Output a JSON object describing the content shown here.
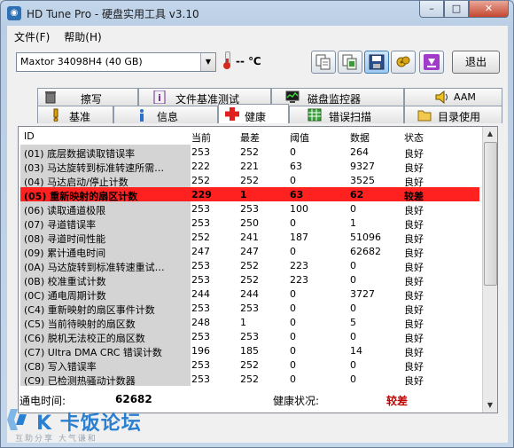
{
  "window": {
    "title": "HD Tune Pro - 硬盘实用工具 v3.10",
    "buttons": {
      "minimize": "0",
      "maximize": "1",
      "close": "r"
    }
  },
  "menu": [
    "文件(F)",
    "帮助(H)"
  ],
  "toolbar": {
    "drive": "Maxtor 34098H4 (40 GB)",
    "temperature": "-- ℃",
    "exit_label": "退出",
    "icons": [
      "copy-text-icon",
      "copy-screen-icon",
      "save-icon",
      "options-icon",
      "download-icon"
    ]
  },
  "tabs_row1": [
    {
      "label": "擦写",
      "icon": "trash-icon"
    },
    {
      "label": "文件基准测试",
      "icon": "file-info-icon"
    },
    {
      "label": "磁盘监控器",
      "icon": "monitor-icon"
    },
    {
      "label": "AAM",
      "icon": "speaker-icon"
    }
  ],
  "tabs_row2": [
    {
      "label": "基准",
      "icon": "exclamation-icon"
    },
    {
      "label": "信息",
      "icon": "info-icon"
    },
    {
      "label": "健康",
      "icon": "health-cross-icon",
      "active": true
    },
    {
      "label": "错误扫描",
      "icon": "grid-scan-icon"
    },
    {
      "label": "目录使用",
      "icon": "folder-icon"
    }
  ],
  "health": {
    "columns": [
      "ID",
      "当前",
      "最差",
      "阈值",
      "数据",
      "状态"
    ],
    "rows": [
      {
        "id": "(01) 底层数据读取错误率",
        "cur": "253",
        "worst": "252",
        "thr": "0",
        "data": "264",
        "status": "良好"
      },
      {
        "id": "(03) 马达旋转到标准转速所需…",
        "cur": "222",
        "worst": "221",
        "thr": "63",
        "data": "9327",
        "status": "良好"
      },
      {
        "id": "(04) 马达启动/停止计数",
        "cur": "252",
        "worst": "252",
        "thr": "0",
        "data": "3525",
        "status": "良好"
      },
      {
        "id": "(05) 重新映射的扇区计数",
        "cur": "229",
        "worst": "1",
        "thr": "63",
        "data": "62",
        "status": "较差",
        "critical": true
      },
      {
        "id": "(06) 读取通道极限",
        "cur": "253",
        "worst": "253",
        "thr": "100",
        "data": "0",
        "status": "良好"
      },
      {
        "id": "(07) 寻道错误率",
        "cur": "253",
        "worst": "250",
        "thr": "0",
        "data": "1",
        "status": "良好"
      },
      {
        "id": "(08) 寻道时间性能",
        "cur": "252",
        "worst": "241",
        "thr": "187",
        "data": "51096",
        "status": "良好"
      },
      {
        "id": "(09) 累计通电时间",
        "cur": "247",
        "worst": "247",
        "thr": "0",
        "data": "62682",
        "status": "良好"
      },
      {
        "id": "(0A) 马达旋转到标准转速重试…",
        "cur": "253",
        "worst": "252",
        "thr": "223",
        "data": "0",
        "status": "良好"
      },
      {
        "id": "(0B) 校准重试计数",
        "cur": "253",
        "worst": "252",
        "thr": "223",
        "data": "0",
        "status": "良好"
      },
      {
        "id": "(0C) 通电周期计数",
        "cur": "244",
        "worst": "244",
        "thr": "0",
        "data": "3727",
        "status": "良好"
      },
      {
        "id": "(C4) 重新映射的扇区事件计数",
        "cur": "253",
        "worst": "253",
        "thr": "0",
        "data": "0",
        "status": "良好"
      },
      {
        "id": "(C5) 当前待映射的扇区数",
        "cur": "248",
        "worst": "1",
        "thr": "0",
        "data": "5",
        "status": "良好"
      },
      {
        "id": "(C6) 脱机无法校正的扇区数",
        "cur": "253",
        "worst": "253",
        "thr": "0",
        "data": "0",
        "status": "良好"
      },
      {
        "id": "(C7) Ultra DMA CRC 错误计数",
        "cur": "196",
        "worst": "185",
        "thr": "0",
        "data": "14",
        "status": "良好"
      },
      {
        "id": "(C8) 写入错误率",
        "cur": "253",
        "worst": "252",
        "thr": "0",
        "data": "0",
        "status": "良好"
      },
      {
        "id": "(C9) 已检测热骚动计数器",
        "cur": "253",
        "worst": "252",
        "thr": "0",
        "data": "0",
        "status": "良好"
      }
    ]
  },
  "footer": {
    "power_on_label": "通电时间:",
    "power_on_value": "62682",
    "health_label": "健康状况:",
    "health_value": "较差",
    "health_color": "#c00000"
  },
  "watermark": {
    "brand": "K 卡饭论坛",
    "slogan": "互助分享  大气谦和"
  }
}
